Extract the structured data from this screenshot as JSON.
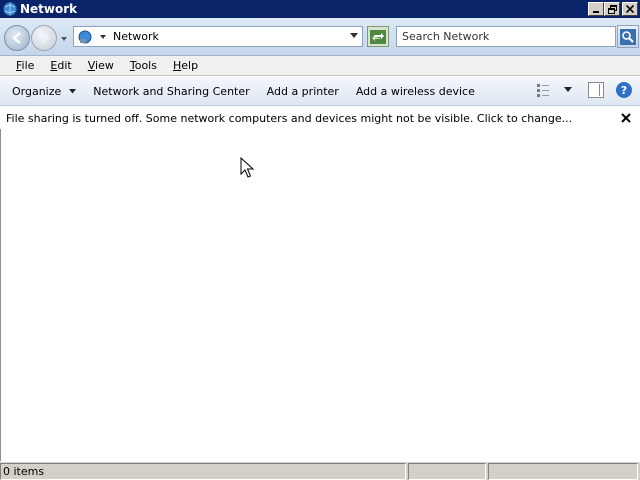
{
  "window": {
    "title": "Network",
    "icon": "network-icon",
    "controls": [
      "minimize-icon",
      "restore-icon",
      "close-icon"
    ]
  },
  "address": {
    "location": "Network",
    "search_placeholder": "Search Network"
  },
  "menu": [
    {
      "accel": "F",
      "rest": "ile"
    },
    {
      "accel": "E",
      "rest": "dit"
    },
    {
      "accel": "V",
      "rest": "iew"
    },
    {
      "accel": "T",
      "rest": "ools"
    },
    {
      "accel": "H",
      "rest": "elp"
    }
  ],
  "commands": {
    "organize": "Organize",
    "network_sharing_center": "Network and Sharing Center",
    "add_printer": "Add a printer",
    "add_wireless": "Add a wireless device"
  },
  "infobar": {
    "message": "File sharing is turned off. Some network computers and devices might not be visible. Click to change..."
  },
  "status": {
    "items": "0 items"
  }
}
